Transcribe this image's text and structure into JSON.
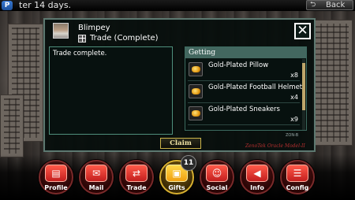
{
  "top_bar": {
    "system_icon": "playstation-icon",
    "message": "ter 14 days.",
    "back_label": "Back",
    "back_icon": "return-arrow-icon"
  },
  "dialog": {
    "player_name": "Blimpey",
    "trade_status": "Trade (Complete)",
    "message": "Trade complete.",
    "getting_title": "Getting",
    "items": [
      {
        "name": "Gold-Plated Pillow",
        "qty": "x8",
        "icon": "gold-pillow-icon"
      },
      {
        "name": "Gold-Plated Football Helmet",
        "qty": "x4",
        "icon": "gold-helmet-icon"
      },
      {
        "name": "Gold-Plated Sneakers",
        "qty": "x9",
        "icon": "gold-sneakers-icon"
      }
    ],
    "tiny_label": "ZON-B",
    "claim_label": "Claim",
    "model_label": "ZenoTek Oracle Model-II"
  },
  "menu": {
    "items": [
      {
        "label": "Profile",
        "icon": "profile-card-icon"
      },
      {
        "label": "Mail",
        "icon": "envelope-icon"
      },
      {
        "label": "Trade",
        "icon": "trade-arrows-icon"
      },
      {
        "label": "Gifts",
        "icon": "gift-box-icon",
        "active": true
      },
      {
        "label": "Social",
        "icon": "people-icon"
      },
      {
        "label": "Info",
        "icon": "megaphone-icon"
      },
      {
        "label": "Config",
        "icon": "sliders-icon"
      }
    ],
    "gifts_badge": "11"
  },
  "colors": {
    "accent_teal": "#43675f",
    "menu_red": "#c31e1e",
    "menu_gold": "#f0a010",
    "model_red": "#b83030"
  }
}
